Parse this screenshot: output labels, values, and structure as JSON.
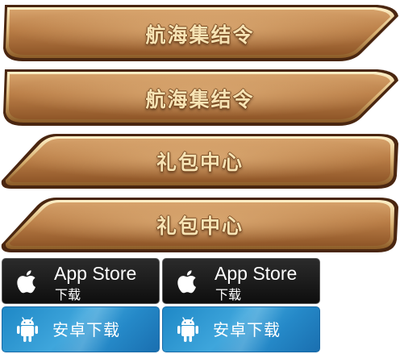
{
  "banners": [
    {
      "label": "航海集结令"
    },
    {
      "label": "航海集结令"
    },
    {
      "label": "礼包中心"
    },
    {
      "label": "礼包中心"
    }
  ],
  "store_buttons": {
    "ios": [
      {
        "title": "App Store",
        "subtitle": "下载",
        "icon": "apple-icon"
      },
      {
        "title": "App Store",
        "subtitle": "下载",
        "icon": "apple-icon"
      }
    ],
    "android": [
      {
        "label": "安卓下载",
        "icon": "android-icon"
      },
      {
        "label": "安卓下载",
        "icon": "android-icon"
      }
    ]
  },
  "colors": {
    "banner_wood": "#b57a45",
    "banner_border": "#5a3012",
    "banner_gold_trim": "#e8c98a",
    "banner_text": "#f6e3b4",
    "ios_bg": "#111111",
    "android_bg": "#2a8fd0"
  }
}
